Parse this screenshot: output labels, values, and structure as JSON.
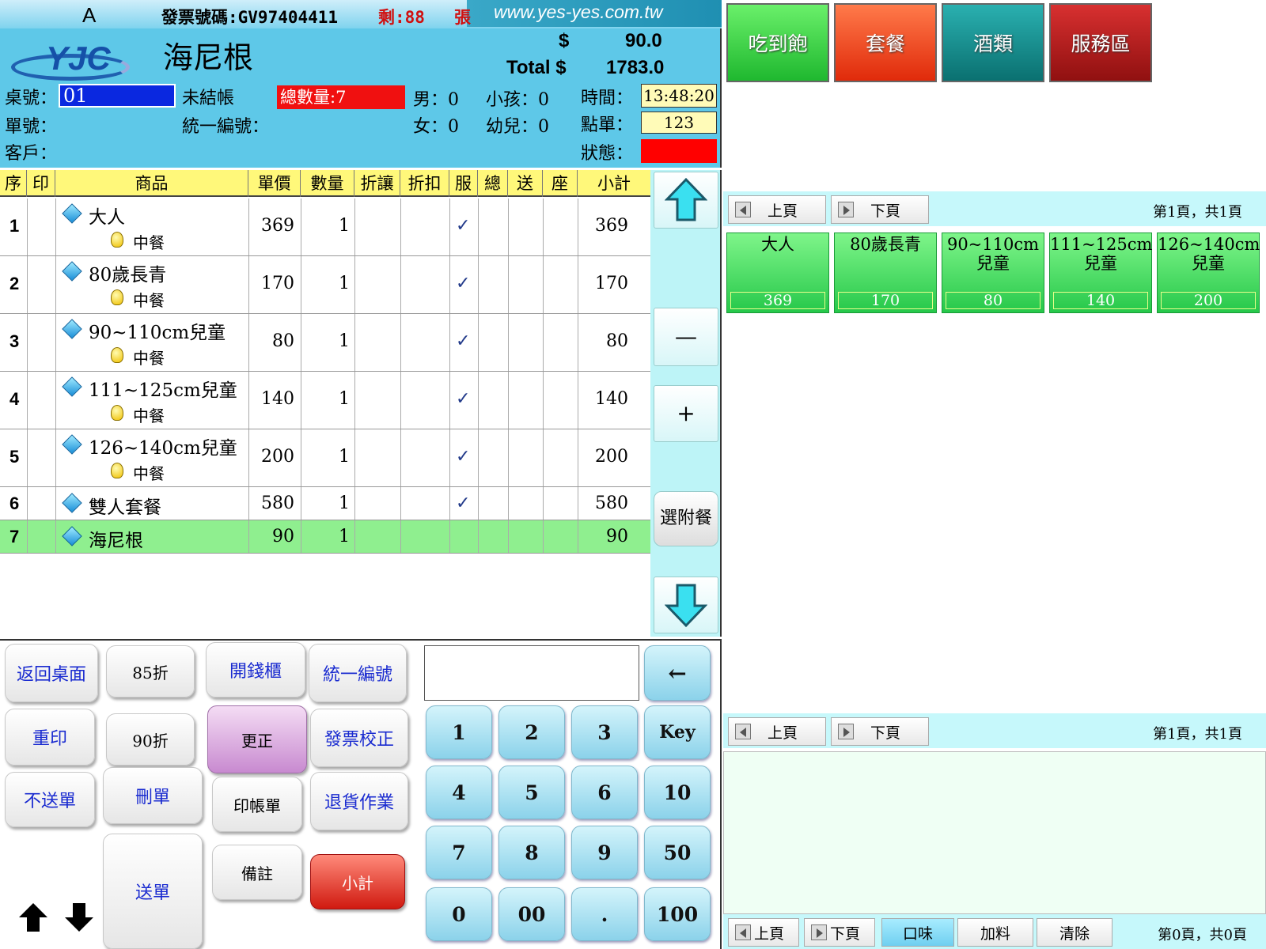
{
  "header": {
    "mode_letter": "A",
    "invoice_label": "發票號碼:GV97404411",
    "remaining_label": "剩:88",
    "remaining_unit": "張",
    "website": "www.yes-yes.com.tw",
    "logo_text": "YJC",
    "current_item": "海尼根",
    "price_symbol": "$",
    "price_value": "90.0",
    "total_label": "Total $",
    "total_value": "1783.0",
    "table_label": "桌號：",
    "table_value": "01",
    "status_text": "未結帳",
    "qty_badge": "總數量:7",
    "male_label": "男：0",
    "child_label": "小孩：0",
    "time_label": "時間：",
    "time_value": "13:48:20",
    "order_label": "單號：",
    "taxid_label": "統一編號：",
    "female_label": "女：0",
    "infant_label": "幼兒：0",
    "ordering_label": "點單：",
    "ordering_value": "123",
    "customer_label": "客戶：",
    "state_label": "狀態："
  },
  "table": {
    "columns": [
      "序",
      "印",
      "商品",
      "單價",
      "數量",
      "折讓",
      "折扣",
      "服",
      "總",
      "送",
      "座",
      "小計"
    ],
    "rows": [
      {
        "seq": "1",
        "name": "大人",
        "sub": "中餐",
        "price": "369",
        "qty": "1",
        "serve": "✓",
        "subtotal": "369"
      },
      {
        "seq": "2",
        "name": "80歲長青",
        "sub": "中餐",
        "price": "170",
        "qty": "1",
        "serve": "✓",
        "subtotal": "170"
      },
      {
        "seq": "3",
        "name": "90~110cm兒童",
        "sub": "中餐",
        "price": "80",
        "qty": "1",
        "serve": "✓",
        "subtotal": "80"
      },
      {
        "seq": "4",
        "name": "111~125cm兒童",
        "sub": "中餐",
        "price": "140",
        "qty": "1",
        "serve": "✓",
        "subtotal": "140"
      },
      {
        "seq": "5",
        "name": "126~140cm兒童",
        "sub": "中餐",
        "price": "200",
        "qty": "1",
        "serve": "✓",
        "subtotal": "200"
      },
      {
        "seq": "6",
        "name": "雙人套餐",
        "price": "580",
        "qty": "1",
        "serve": "✓",
        "subtotal": "580"
      },
      {
        "seq": "7",
        "name": "海尼根",
        "price": "90",
        "qty": "1",
        "subtotal": "90"
      }
    ]
  },
  "side": {
    "minus": "—",
    "plus": "+",
    "addon": "選附餐"
  },
  "buttons": {
    "back_desk": "返回桌面",
    "disc85": "85折",
    "cash_drawer": "開錢櫃",
    "taxid": "統一編號",
    "reprint": "重印",
    "disc90": "90折",
    "correct": "更正",
    "invoice_fix": "發票校正",
    "no_send": "不送單",
    "delete_order": "刪單",
    "print_bill": "印帳單",
    "return_goods": "退貨作業",
    "send_order": "送單",
    "note": "備註",
    "subtotal": "小計"
  },
  "numpad": {
    "backspace": "←",
    "keys": [
      "1",
      "2",
      "3",
      "Key",
      "4",
      "5",
      "6",
      "10",
      "7",
      "8",
      "9",
      "50",
      "0",
      "00",
      ".",
      "100"
    ]
  },
  "categories": [
    {
      "label": "吃到飽",
      "color": "#2fcf3f"
    },
    {
      "label": "套餐",
      "color": "#f0401a"
    },
    {
      "label": "酒類",
      "color": "#1a8f8f"
    },
    {
      "label": "服務區",
      "color": "#b01818"
    }
  ],
  "paging": {
    "prev": "上頁",
    "next": "下頁",
    "info1": "第1頁，共1頁",
    "info2": "第1頁，共1頁",
    "info3": "第0頁，共0頁"
  },
  "products": [
    {
      "name": "大人",
      "price": "369"
    },
    {
      "name": "80歲長青",
      "price": "170"
    },
    {
      "name": "90~110cm兒童",
      "price": "80"
    },
    {
      "name": "111~125cm兒童",
      "price": "140"
    },
    {
      "name": "126~140cm兒童",
      "price": "200"
    }
  ],
  "bottom_tools": {
    "flavor": "口味",
    "topping": "加料",
    "clear": "清除"
  }
}
